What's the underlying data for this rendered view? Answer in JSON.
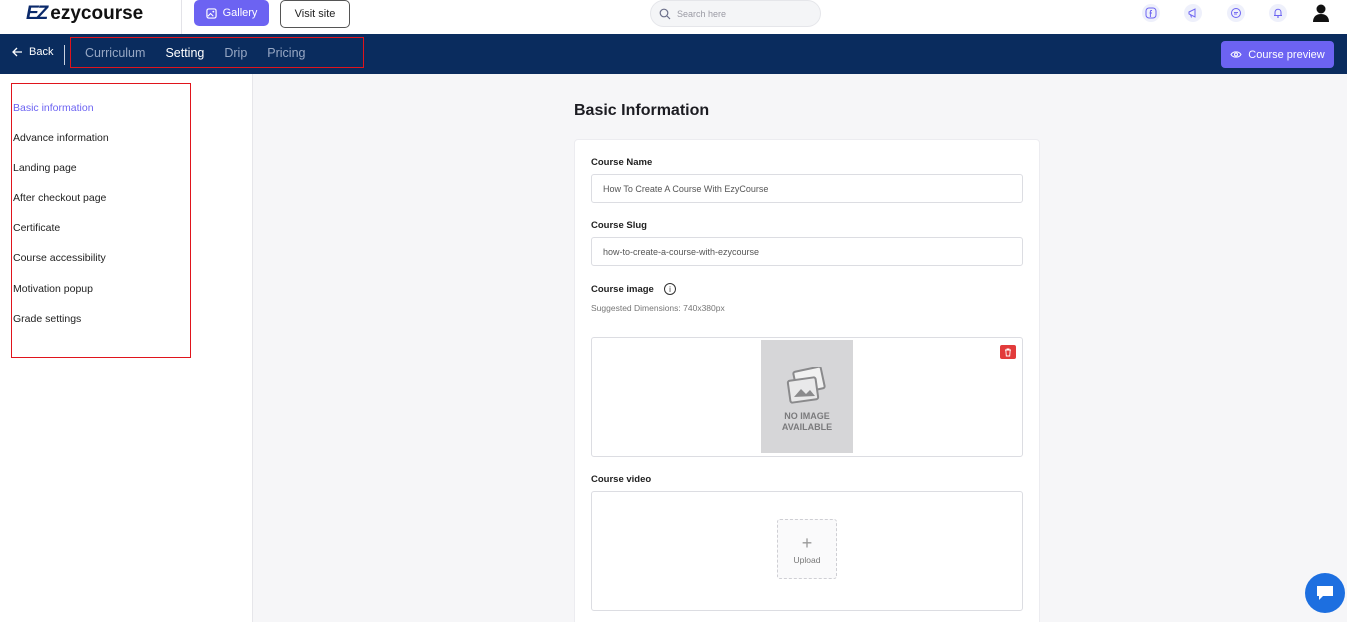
{
  "brand": {
    "logo_mark": "EZ",
    "name": "ezycourse"
  },
  "topbar": {
    "gallery_label": "Gallery",
    "visit_site_label": "Visit site",
    "search_placeholder": "Search here",
    "icons": [
      "facebook-icon",
      "megaphone-icon",
      "chat-bubble-icon",
      "bell-icon",
      "user-avatar-icon"
    ]
  },
  "navbar": {
    "back_label": "Back",
    "tabs": [
      "Curriculum",
      "Setting",
      "Drip",
      "Pricing"
    ],
    "active_tab": "Setting",
    "preview_label": "Course preview"
  },
  "sidebar": {
    "items": [
      "Basic information",
      "Advance information",
      "Landing page",
      "After checkout page",
      "Certificate",
      "Course accessibility",
      "Motivation popup",
      "Grade settings"
    ],
    "active_item": "Basic information"
  },
  "main": {
    "title": "Basic Information",
    "course_name_label": "Course Name",
    "course_name_value": "How To Create A Course With EzyCourse",
    "course_slug_label": "Course Slug",
    "course_slug_value": "how-to-create-a-course-with-ezycourse",
    "course_image_label": "Course image",
    "course_image_hint": "Suggested Dimensions: 740x380px",
    "no_image_line1": "NO IMAGE",
    "no_image_line2": "AVAILABLE",
    "course_video_label": "Course video",
    "upload_label": "Upload"
  },
  "colors": {
    "accent": "#6c63f2",
    "navy": "#0a2c5e",
    "highlight_border": "#e0141c",
    "chat": "#1d6fe0"
  }
}
